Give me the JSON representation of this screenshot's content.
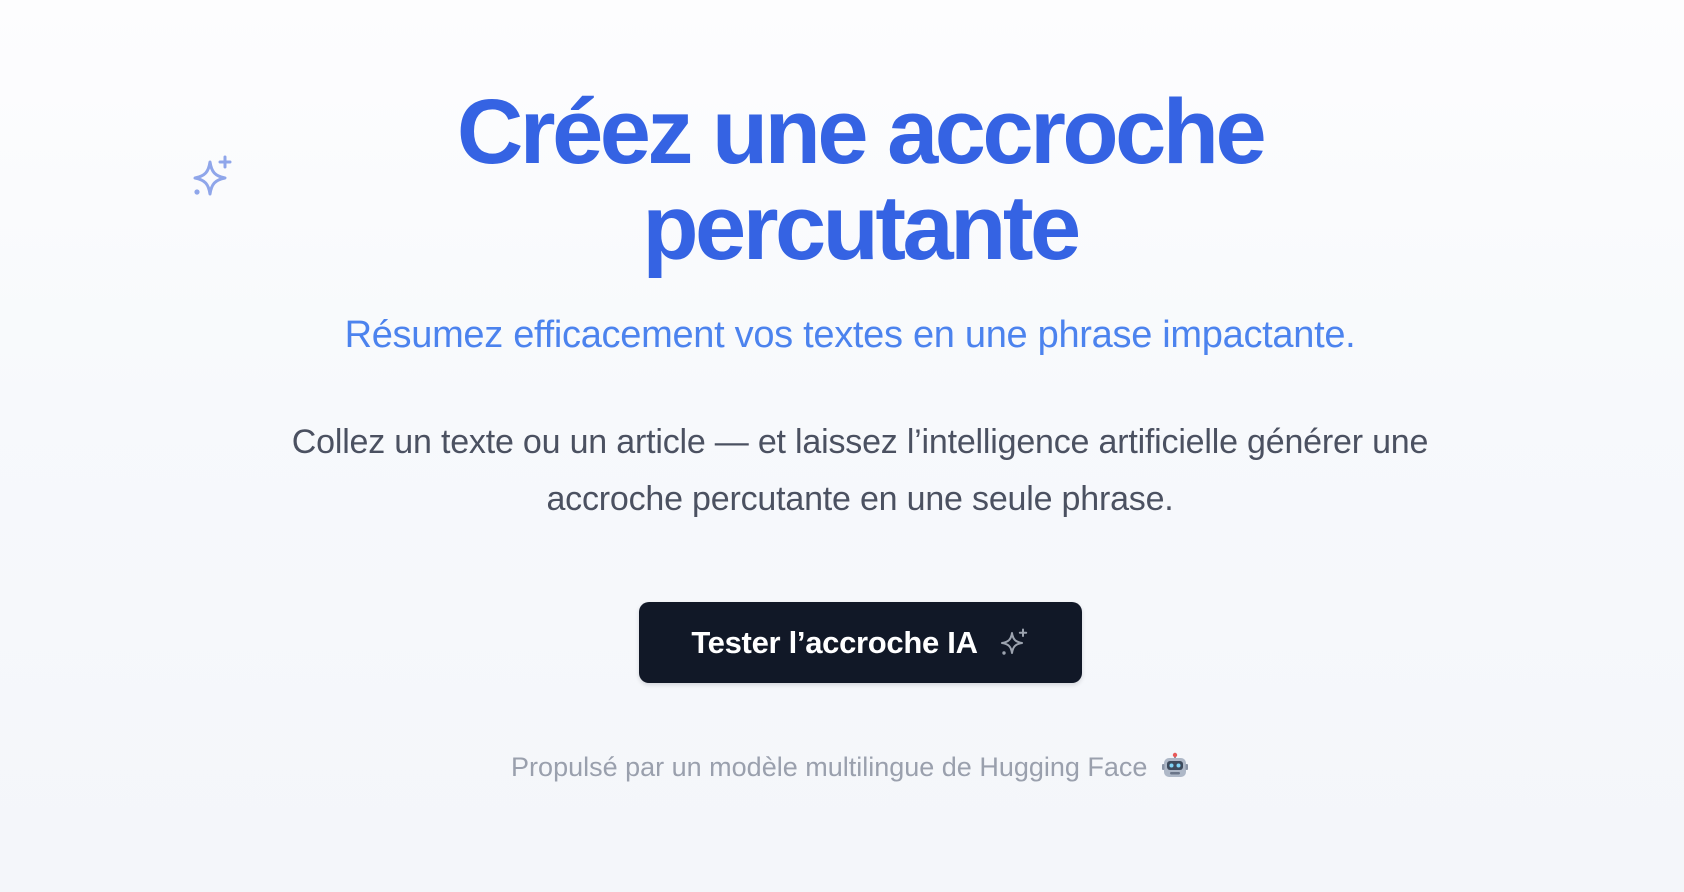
{
  "hero": {
    "title_line1": "Créez une accroche",
    "title_line2": "percutante",
    "subtitle": "Résumez efficacement vos textes en une phrase impactante.",
    "description_line1": "Collez un texte ou un article — et laissez l’intelligence artificielle générer une",
    "description_line2": "accroche percutante en une seule phrase."
  },
  "cta": {
    "label": "Tester l’accroche IA",
    "icon": "sparkles-icon"
  },
  "footer": {
    "note": "Propulsé par un modèle multilingue de Hugging Face",
    "icon": "robot-icon"
  },
  "decoration": {
    "icon": "sparkles-icon"
  },
  "colors": {
    "title": "#3563e3",
    "subtitle": "#4c83ee",
    "body_text": "#4b5161",
    "button_bg": "#111827",
    "muted": "#9aa0ad"
  }
}
